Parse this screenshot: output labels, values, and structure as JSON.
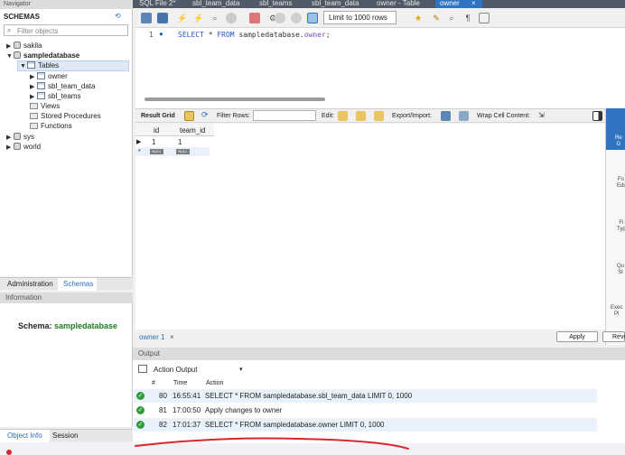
{
  "navigator": {
    "title": "Navigator",
    "schemas_title": "SCHEMAS",
    "filter_placeholder": "Filter objects",
    "tree": {
      "sakila": "sakila",
      "sampledatabase": "sampledatabase",
      "tables": "Tables",
      "owner": "owner",
      "sbl_team_data": "sbl_team_data",
      "sbl_teams": "sbl_teams",
      "views": "Views",
      "stored_procedures": "Stored Procedures",
      "functions": "Functions",
      "sys": "sys",
      "world": "world"
    },
    "tabs": {
      "administration": "Administration",
      "schemas": "Schemas"
    },
    "information": {
      "header": "Information",
      "schema_label": "Schema: ",
      "schema_value": "sampledatabase"
    },
    "bottom_tabs": {
      "object_info": "Object Info",
      "session": "Session"
    }
  },
  "editor_tabs": [
    "SQL File 2*",
    "sbl_team_data",
    "sbl_teams",
    "sbl_team_data",
    "owner - Table",
    "owner"
  ],
  "active_tab_close": "×",
  "toolbar": {
    "limit": "Limit to 1000 rows"
  },
  "editor": {
    "line_number": "1",
    "sql_kw1": "SELECT",
    "sql_star": " * ",
    "sql_kw2": "FROM",
    "sql_schema": " sampledatabase.",
    "sql_table": "owner",
    "sql_end": ";"
  },
  "result_toolbar": {
    "result_grid": "Result Grid",
    "filter_rows": "Filter Rows:",
    "edit": "Edit:",
    "export_import": "Export/Import:",
    "wrap_cell": "Wrap Cell Content:"
  },
  "grid": {
    "columns": [
      "id",
      "team_id"
    ],
    "rows": [
      [
        "1",
        "1"
      ]
    ],
    "null_label": "NULL"
  },
  "right_panel": {
    "result_grid": "Re\nG",
    "form_editor": "Fo\nEdi",
    "field_types": "Fi\nTyp",
    "query_stats": "Qu\nSt",
    "execution_plan": "Exec\nPl"
  },
  "result_tab": "owner 1",
  "result_tab_close": "×",
  "buttons": {
    "apply": "Apply",
    "revert": "Reve"
  },
  "output": {
    "header": "Output",
    "selector": "Action Output",
    "columns": {
      "num": "#",
      "time": "Time",
      "action": "Action"
    },
    "rows": [
      {
        "num": "80",
        "time": "16:55:41",
        "action": "SELECT * FROM sampledatabase.sbl_team_data LIMIT 0, 1000"
      },
      {
        "num": "81",
        "time": "17:00:50",
        "action": "Apply changes to owner"
      },
      {
        "num": "82",
        "time": "17:01:37",
        "action": "SELECT * FROM sampledatabase.owner LIMIT 0, 1000"
      }
    ]
  },
  "colors": {
    "accent": "#2f74c0",
    "success": "#2e9d3a",
    "annotation": "#d9262b",
    "schema_text": "#1f7a1f"
  }
}
